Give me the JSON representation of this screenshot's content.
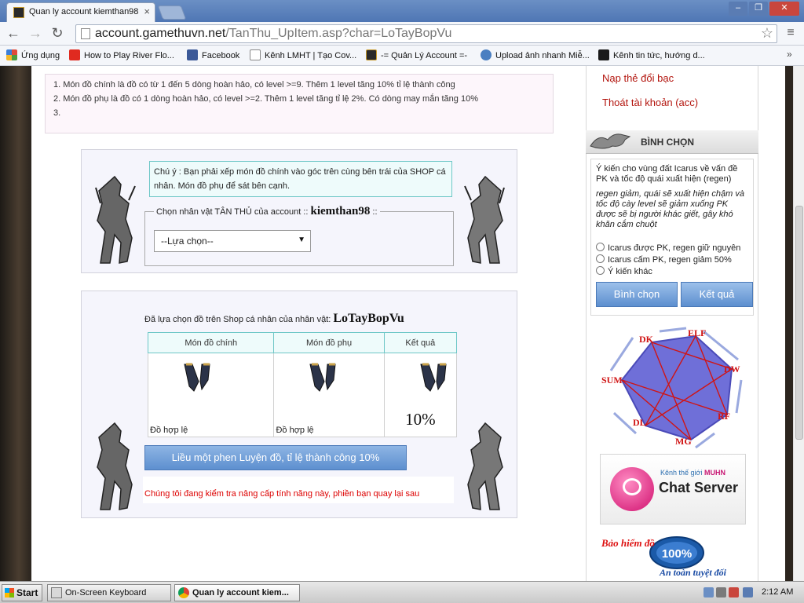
{
  "browser": {
    "tab_title": "Quan ly account kiemthan98",
    "tab_close": "×",
    "url_domain": "account.gamethuvn.net",
    "url_path": "/TanThu_UpItem.asp?char=LoTayBopVu",
    "window_buttons": {
      "minimize": "–",
      "maximize": "❐",
      "close": "✕"
    },
    "nav": {
      "back": "←",
      "forward": "→",
      "reload": "↻"
    },
    "star": "☆",
    "menu": "≡"
  },
  "bookmarks": [
    {
      "label": "Ứng dụng",
      "icon": "apps-grid-icon",
      "color": "#e04a3a"
    },
    {
      "label": "How to Play River Flo...",
      "icon": "youtube-icon",
      "color": "#e02a20"
    },
    {
      "label": "Facebook",
      "icon": "facebook-icon",
      "color": "#3b5998"
    },
    {
      "label": "Kênh LMHT | Tạo Cov...",
      "icon": "page-icon",
      "color": "#ffffff"
    },
    {
      "label": "-= Quản Lý Account =-",
      "icon": "game-icon",
      "color": "#2a2a2a"
    },
    {
      "label": "Upload ảnh nhanh Miễ...",
      "icon": "cloud-upload-icon",
      "color": "#4a7fc1"
    },
    {
      "label": "Kênh tin tức, hướng d...",
      "icon": "game-icon",
      "color": "#1a1a1a"
    }
  ],
  "bookmarks_more": "»",
  "rules": [
    "1. Món đồ chính là đồ có từ 1 đến 5 dòng hoàn hảo, có level >=9. Thêm 1 level tăng 10% tỉ lệ thành công",
    "2. Món đồ phụ là đồ có 1 dòng hoàn hảo, có level >=2. Thêm 1 level tăng tỉ lệ 2%. Có dòng may mắn tăng 10%",
    "3."
  ],
  "select_char": {
    "note": "Chú ý : Bạn phải xếp món đồ chính vào góc trên cùng bên trái của SHOP cá nhân. Món đồ phụ để sát bên cạnh.",
    "legend": "Chọn nhân vật TÂN THỦ của account :: ",
    "account": "kiemthan98",
    "legend_end": " ::",
    "dropdown_value": "--Lựa chọn--"
  },
  "upgrade": {
    "chosen_text": "Đã lựa chọn đồ trên Shop cá nhân của nhân vật: ",
    "character": "LoTayBopVu",
    "columns": [
      "Món đồ chính",
      "Món đồ phụ",
      "Kết quả"
    ],
    "main_status": "Đồ hợp lệ",
    "sub_status": "Đồ hợp lệ",
    "result_rate": "10%",
    "button_label": "Liều một phen Luyện đồ, tỉ lệ thành công 10%",
    "warning": "Chúng tôi đang kiểm tra nâng cấp tính năng này, phiền bạn quay lại sau"
  },
  "sidebar": {
    "links": [
      "Nạp thẻ đổi bạc",
      "Thoát tài khoản (acc)"
    ],
    "poll_header": "BÌNH CHỌN",
    "poll_question": "Ý kiến cho vùng đất Icarus về vấn đề PK và tốc độ quái xuất hiện (regen)",
    "poll_desc": "regen giảm, quái sẽ xuất hiện chậm và tốc độ cày level sẽ giảm xuống PK được sẽ bị người khác giết, gây khó khăn cắm chuột",
    "poll_options": [
      "Icarus được PK, regen giữ nguyên",
      "Icarus cấm PK, regen giảm 50%",
      "Ý kiến khác"
    ],
    "vote_button": "Bình chọn",
    "result_button": "Kết quả",
    "classes": [
      "DK",
      "ELF",
      "DW",
      "RF",
      "MG",
      "DL",
      "SUM"
    ],
    "chat_line1": "Kênh thế giới ",
    "chat_brand": "MUHN",
    "chat_line2": "Chat Server",
    "insure_top": "Bảo hiểm đồ",
    "insure_seal": "100%",
    "insure_bottom": "An toàn tuyệt đối"
  },
  "taskbar": {
    "start": "Start",
    "tasks": [
      "On-Screen Keyboard",
      "Quan ly account kiem..."
    ],
    "clock": "2:12 AM"
  },
  "colors": {
    "link_red": "#b3150e",
    "button_blue": "#5d8fcf",
    "warn_red": "#dd0000",
    "note_border": "#6ec7c7"
  }
}
